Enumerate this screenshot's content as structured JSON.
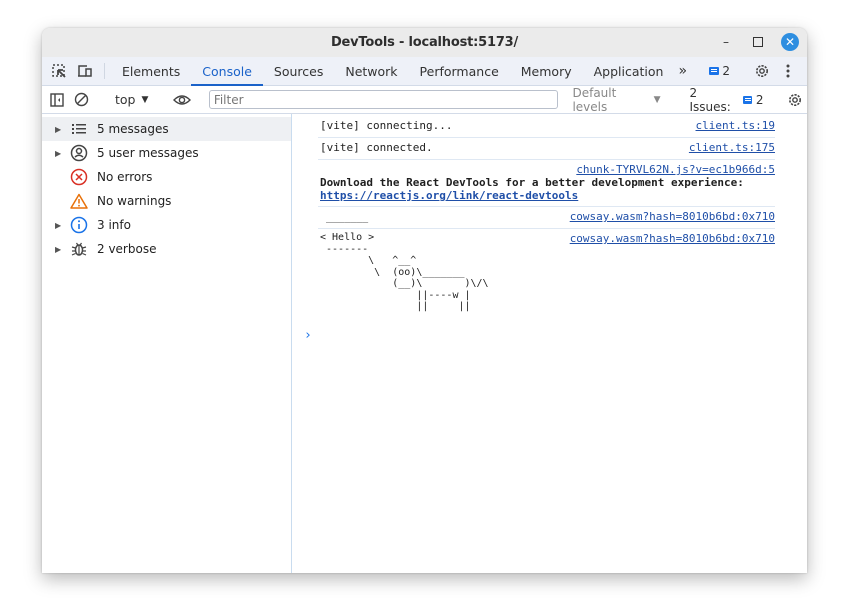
{
  "window": {
    "title": "DevTools - localhost:5173/",
    "controls": {
      "minimize": "–",
      "maximize": "☐",
      "close": "✕"
    }
  },
  "tabs": {
    "items": [
      {
        "label": "Elements"
      },
      {
        "label": "Console",
        "active": true
      },
      {
        "label": "Sources"
      },
      {
        "label": "Network"
      },
      {
        "label": "Performance"
      },
      {
        "label": "Memory"
      },
      {
        "label": "Application"
      }
    ],
    "more": "»",
    "issues_badge_count": "2"
  },
  "toolbar": {
    "context": "top",
    "filter_placeholder": "Filter",
    "levels_label": "Default levels",
    "issues_label": "2 Issues:",
    "issues_count": "2"
  },
  "sidebar": {
    "items": [
      {
        "label": "5 messages",
        "icon": "list-icon",
        "expandable": true,
        "selected": true
      },
      {
        "label": "5 user messages",
        "icon": "user-icon",
        "expandable": true
      },
      {
        "label": "No errors",
        "icon": "error-icon",
        "expandable": false
      },
      {
        "label": "No warnings",
        "icon": "warning-icon",
        "expandable": false
      },
      {
        "label": "3 info",
        "icon": "info-icon",
        "expandable": true
      },
      {
        "label": "2 verbose",
        "icon": "bug-icon",
        "expandable": true
      }
    ]
  },
  "console": {
    "messages": [
      {
        "text": "[vite] connecting...",
        "source": "client.ts:19"
      },
      {
        "text": "[vite] connected.",
        "source": "client.ts:175"
      },
      {
        "source": "chunk-TYRVL62N.js?v=ec1b966d:5",
        "bold_text": "Download the React DevTools for a better development experience:",
        "link": "https://reactjs.org/link/react-devtools"
      },
      {
        "text": " _______",
        "source": "cowsay.wasm?hash=8010b6bd:0x710"
      },
      {
        "text": "< Hello >\n -------\n        \\   ^__^\n         \\  (oo)\\_______\n            (__)\\       )\\/\\\n                ||----w |\n                ||     ||",
        "source": "cowsay.wasm?hash=8010b6bd:0x710"
      }
    ],
    "prompt": "›"
  },
  "colors": {
    "accent": "#1a62c9",
    "link": "#1f4fa8",
    "error": "#d93025",
    "warning": "#e8710a",
    "info": "#1a73e8"
  }
}
